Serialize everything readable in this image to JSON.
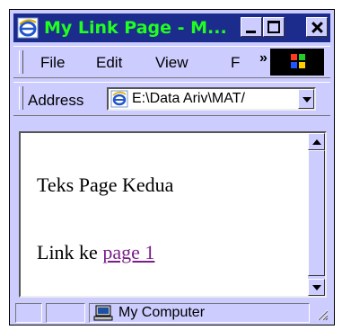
{
  "window": {
    "title": "My Link Page - M..."
  },
  "menubar": {
    "items": [
      "File",
      "Edit",
      "View",
      "F"
    ],
    "overflow": "»"
  },
  "address": {
    "label": "Address",
    "value": "E:\\Data Ariv\\MAT/"
  },
  "page": {
    "heading_text": "Teks Page Kedua",
    "link_prefix": "Link ke",
    "link_text": "page 1"
  },
  "status": {
    "zone": "My Computer"
  },
  "colors": {
    "title_bar": "#1c2c8c",
    "title_text": "#20ff20",
    "chrome": "#ccccff",
    "link_visited": "#7a1f8a"
  }
}
